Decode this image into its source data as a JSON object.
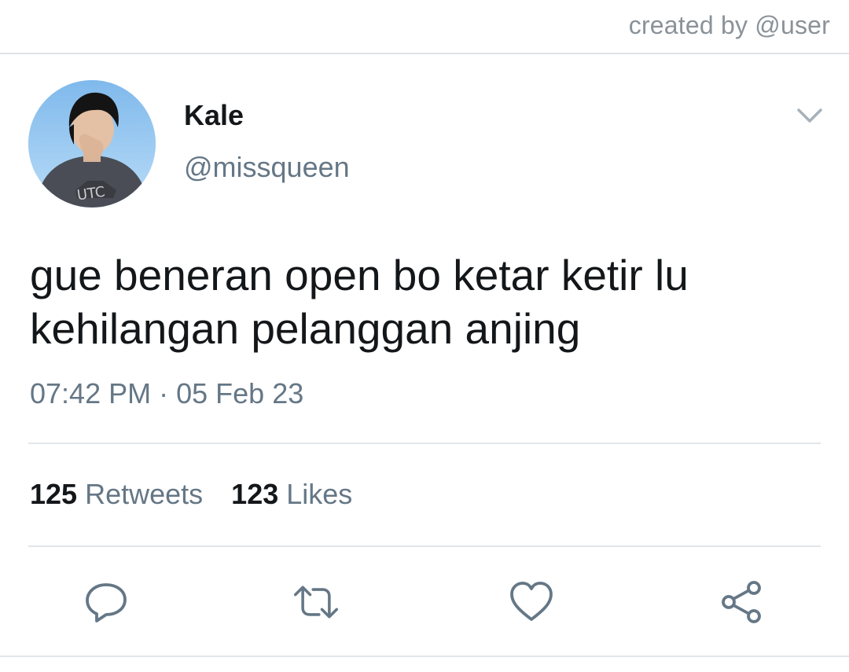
{
  "watermark": "created by @user",
  "tweet": {
    "display_name": "Kale",
    "handle": "@missqueen",
    "text_lines": [
      "gue beneran open bo ketar ketir lu",
      "kehilangan pelanggan anjing"
    ],
    "time": "07:42 PM",
    "separator": "·",
    "date": "05 Feb 23"
  },
  "stats": {
    "retweets_count": "125",
    "retweets_label": "Retweets",
    "likes_count": "123",
    "likes_label": "Likes"
  },
  "icons": {
    "menu": "chevron-down-icon",
    "reply": "reply-icon",
    "retweet": "retweet-icon",
    "like": "heart-icon",
    "share": "share-icon"
  },
  "colors": {
    "icon": "#657786",
    "text": "#14171a",
    "muted": "#657786",
    "rule": "#e1e6ea"
  }
}
